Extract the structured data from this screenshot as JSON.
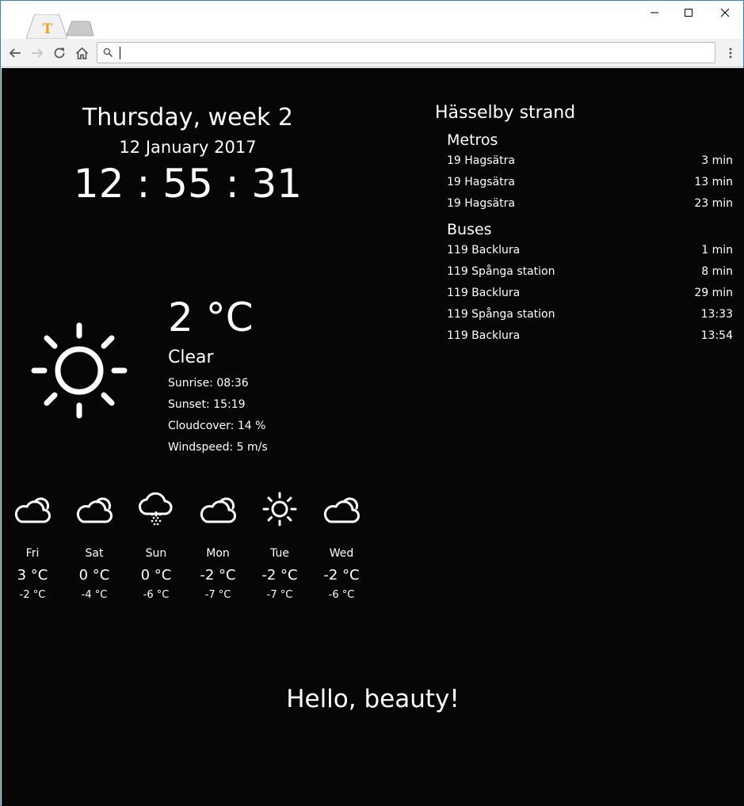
{
  "browser": {
    "tab_logo_letter": "T",
    "accent_color": "#f29c1b"
  },
  "clock": {
    "day_week": "Thursday, week 2",
    "date": "12 January 2017",
    "time": "12 : 55 : 31"
  },
  "weather": {
    "icon": "sun-icon",
    "temperature": "2 °C",
    "condition": "Clear",
    "sunrise": "Sunrise: 08:36",
    "sunset": "Sunset: 15:19",
    "cloudcover": "Cloudcover: 14 %",
    "windspeed": "Windspeed: 5 m/s"
  },
  "forecast": [
    {
      "day": "Fri",
      "high": "3 °C",
      "low": "-2 °C",
      "icon": "partly-cloudy-icon"
    },
    {
      "day": "Sat",
      "high": "0 °C",
      "low": "-4 °C",
      "icon": "partly-cloudy-icon"
    },
    {
      "day": "Sun",
      "high": "0 °C",
      "low": "-6 °C",
      "icon": "snow-icon"
    },
    {
      "day": "Mon",
      "high": "-2 °C",
      "low": "-7 °C",
      "icon": "partly-cloudy-icon"
    },
    {
      "day": "Tue",
      "high": "-2 °C",
      "low": "-7 °C",
      "icon": "sun-icon"
    },
    {
      "day": "Wed",
      "high": "-2 °C",
      "low": "-6 °C",
      "icon": "partly-cloudy-icon"
    }
  ],
  "transit": {
    "station": "Hässelby strand",
    "metros_title": "Metros",
    "metros": [
      {
        "destination": "19 Hagsätra",
        "time": "3 min"
      },
      {
        "destination": "19 Hagsätra",
        "time": "13 min"
      },
      {
        "destination": "19 Hagsätra",
        "time": "23 min"
      }
    ],
    "buses_title": "Buses",
    "buses": [
      {
        "destination": "119 Backlura",
        "time": "1 min"
      },
      {
        "destination": "119 Spånga station",
        "time": "8 min"
      },
      {
        "destination": "119 Backlura",
        "time": "29 min"
      },
      {
        "destination": "119 Spånga station",
        "time": "13:33"
      },
      {
        "destination": "119 Backlura",
        "time": "13:54"
      }
    ]
  },
  "greeting": "Hello, beauty!"
}
